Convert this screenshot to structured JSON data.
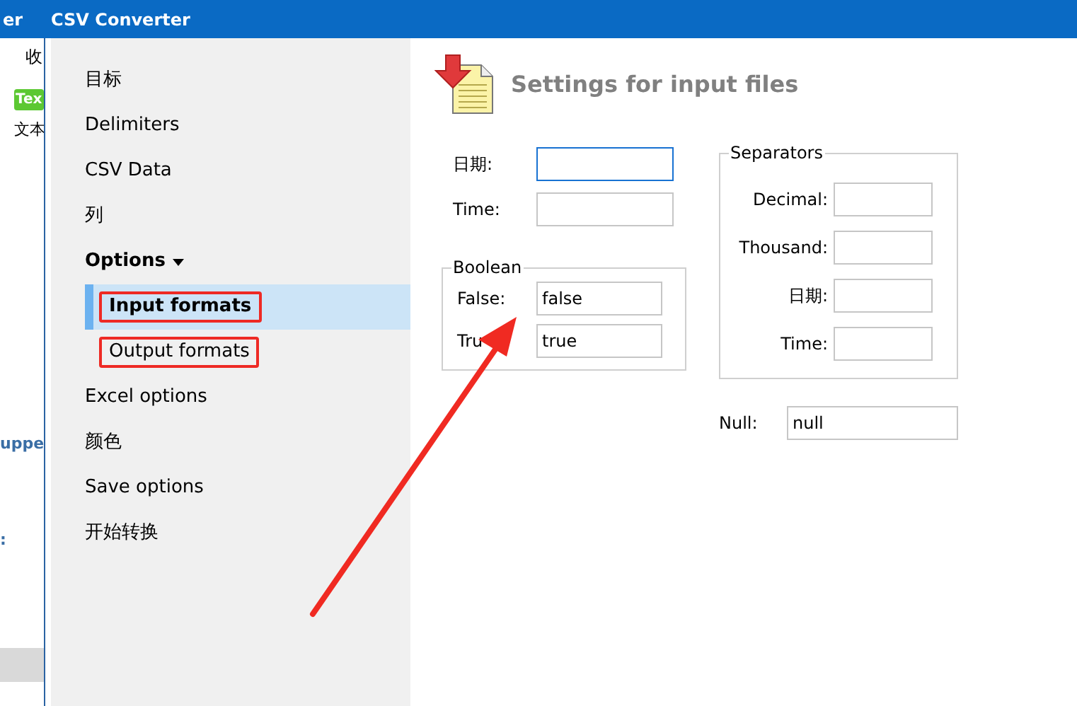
{
  "background_window": {
    "title": "er",
    "items": [
      {
        "kind": "text",
        "text": "收"
      },
      {
        "kind": "tag",
        "text": "Tex"
      },
      {
        "kind": "text",
        "text": "文本"
      },
      {
        "kind": "link",
        "text": "uppe"
      },
      {
        "kind": "link",
        "text": ":"
      },
      {
        "kind": "bar"
      }
    ]
  },
  "window": {
    "title": "CSV Converter"
  },
  "sidebar": {
    "items": [
      {
        "label": "目标",
        "selected": false
      },
      {
        "label": "Delimiters",
        "selected": false
      },
      {
        "label": "CSV Data",
        "selected": false
      },
      {
        "label": "列",
        "selected": false
      },
      {
        "label": "Options",
        "selected": false,
        "expanded": true,
        "children": [
          {
            "label": "Input formats",
            "selected": true,
            "annotated": true
          },
          {
            "label": "Output formats",
            "selected": false,
            "annotated": true
          }
        ]
      },
      {
        "label": "Excel options",
        "selected": false
      },
      {
        "label": "颜色",
        "selected": false
      },
      {
        "label": "Save options",
        "selected": false
      },
      {
        "label": "开始转换",
        "selected": false
      }
    ]
  },
  "header": {
    "title": "Settings for input files"
  },
  "fields": [
    {
      "label": "日期:",
      "focused": true
    },
    {
      "label": "Time:",
      "focused": false
    }
  ],
  "boolean": {
    "title": "Boolean",
    "fields": [
      {
        "label": "False:",
        "value": "false"
      },
      {
        "label": "Tru",
        "value": "true"
      }
    ]
  },
  "separators": {
    "title": "Separators",
    "fields": [
      {
        "label": "Decimal:"
      },
      {
        "label": "Thousand:"
      },
      {
        "label": "日期:"
      },
      {
        "label": "Time:"
      }
    ]
  },
  "null_field": {
    "label": "Null:",
    "value": "null"
  }
}
